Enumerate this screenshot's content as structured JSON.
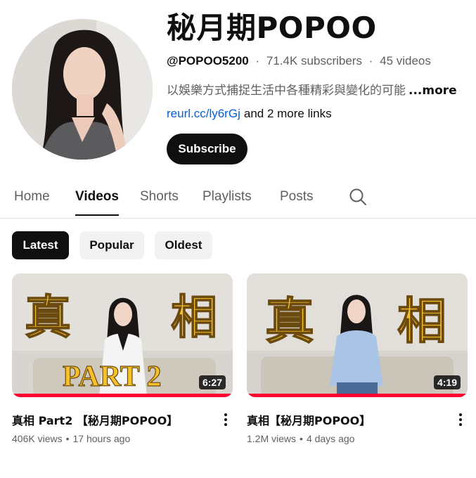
{
  "channel": {
    "title": "秘月期POPOO",
    "handle": "@POPOO5200",
    "subscribers": "71.4K subscribers",
    "videos_count": "45 videos",
    "separator": "·",
    "description": "以娛樂方式捕捉生活中各種精彩與變化的可能",
    "more_label": "...more",
    "link_text": "reurl.cc/ly6rGj",
    "more_links": "and 2 more links",
    "subscribe_label": "Subscribe"
  },
  "tabs": [
    {
      "label": "Home"
    },
    {
      "label": "Videos"
    },
    {
      "label": "Shorts"
    },
    {
      "label": "Playlists"
    },
    {
      "label": "Posts"
    }
  ],
  "active_tab": "Videos",
  "search_icon": "search-icon",
  "filters": [
    {
      "label": "Latest"
    },
    {
      "label": "Popular"
    },
    {
      "label": "Oldest"
    }
  ],
  "selected_filter": "Latest",
  "videos": [
    {
      "title": "真相 Part2 【秘月期POPOO】",
      "views": "406K views",
      "age": "17 hours ago",
      "duration": "6:27",
      "thumb_left_char": "真",
      "thumb_right_char": "相",
      "thumb_banner": "PART 2",
      "watched_fraction": 1.0
    },
    {
      "title": "真相【秘月期POPOO】",
      "views": "1.2M views",
      "age": "4 days ago",
      "duration": "4:19",
      "thumb_left_char": "真",
      "thumb_right_char": "相",
      "watched_fraction": 1.0
    }
  ],
  "colors": {
    "accent_red": "#ff0033",
    "link_blue": "#065fd4",
    "thumb_text_yellow": "#f6c12a"
  }
}
